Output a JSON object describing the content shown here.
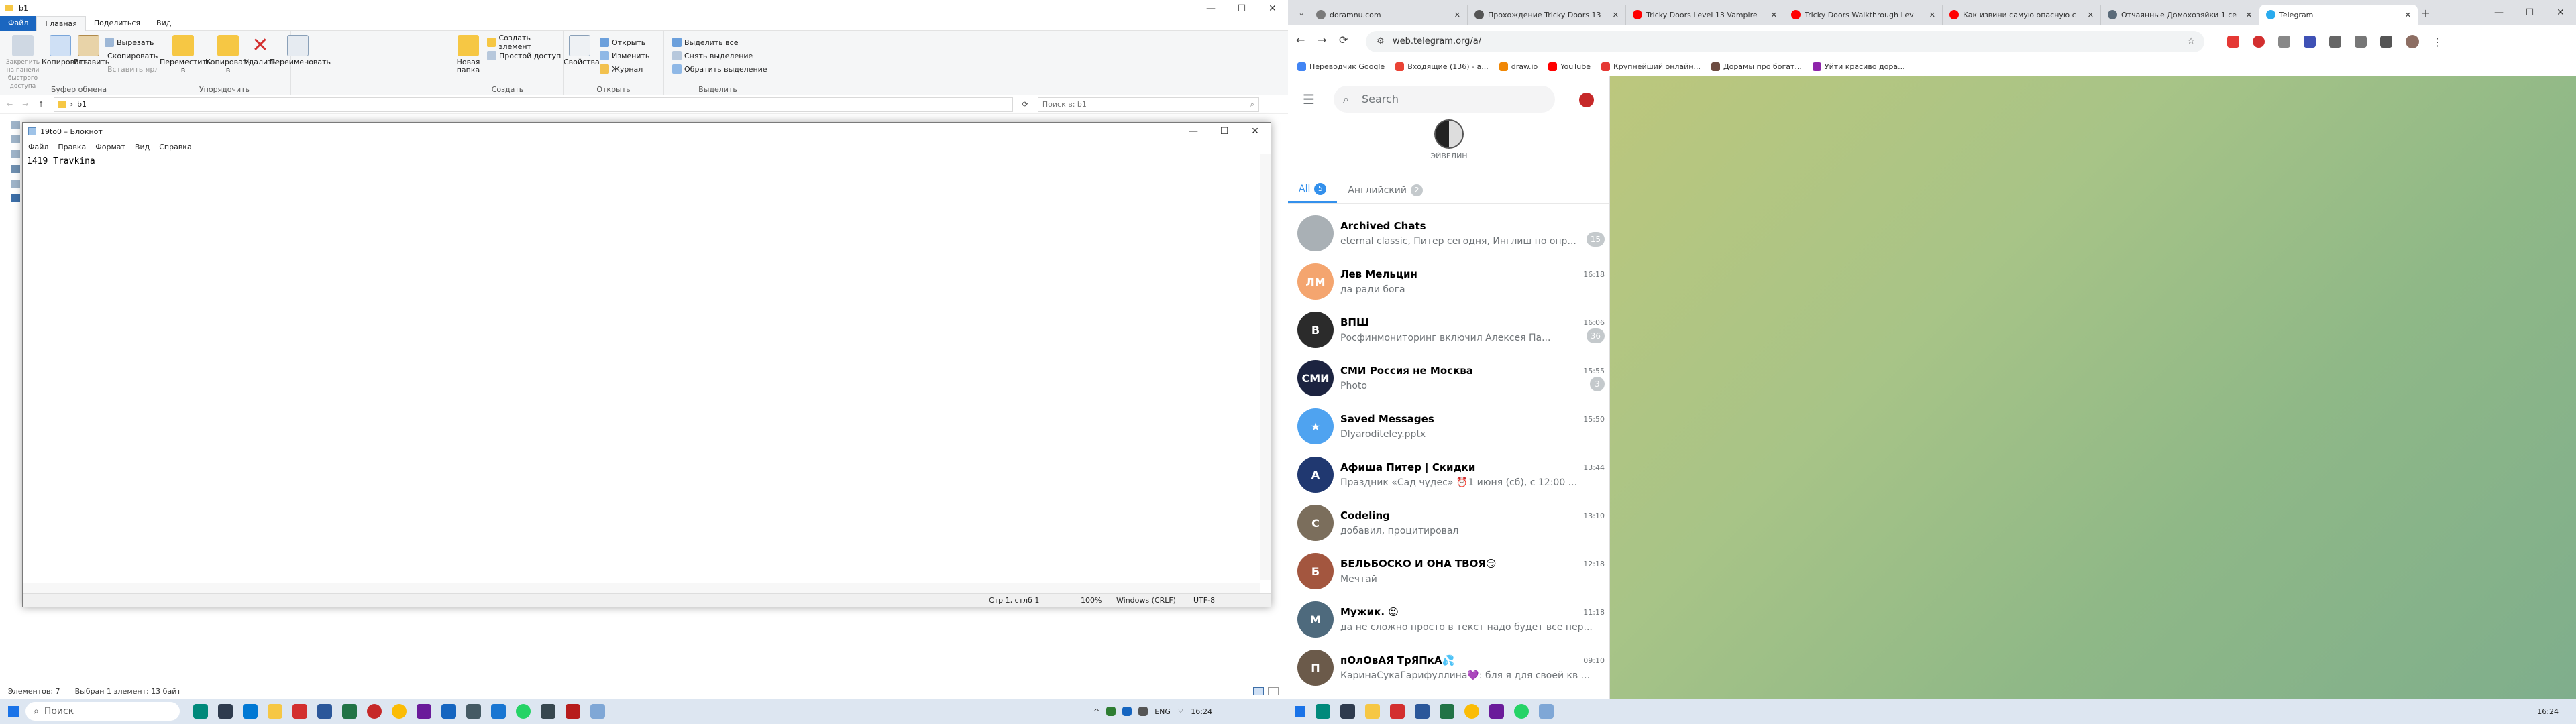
{
  "explorer": {
    "path_title": "b1",
    "window_buttons": [
      "—",
      "☐",
      "✕"
    ],
    "ribbon_tabs": [
      "Файл",
      "Главная",
      "Поделиться",
      "Вид"
    ],
    "clipboard": {
      "pin": "Закрепить на панели быстрого доступа",
      "copy": "Копировать",
      "paste": "Вставить",
      "cut": "Вырезать",
      "copy_path": "Скопировать путь",
      "paste_shortcut": "Вставить ярлык",
      "label": "Буфер обмена"
    },
    "organize": {
      "move": "Переместить в",
      "copy_to": "Копировать в",
      "delete": "Удалить",
      "rename": "Переименовать",
      "label": "Упорядочить"
    },
    "create": {
      "new_folder": "Новая папка",
      "new_item": "Создать элемент",
      "easy_access": "Простой доступ",
      "label": "Создать"
    },
    "open": {
      "properties": "Свойства",
      "open": "Открыть",
      "edit": "Изменить",
      "history": "Журнал",
      "label": "Открыть"
    },
    "select": {
      "all": "Выделить все",
      "none": "Снять выделение",
      "invert": "Обратить выделение",
      "label": "Выделить"
    },
    "address": "b1",
    "search_placeholder": "Поиск в: b1",
    "status_count": "Элементов: 7",
    "status_selected": "Выбран 1 элемент: 13 байт"
  },
  "notepad": {
    "title": "19to0 – Блокнот",
    "menu": [
      "Файл",
      "Правка",
      "Формат",
      "Вид",
      "Справка"
    ],
    "content": "1419 Travkina",
    "status": {
      "position": "Стр 1, стлб 1",
      "zoom": "100%",
      "eol": "Windows (CRLF)",
      "encoding": "UTF-8"
    }
  },
  "chrome": {
    "tabs": [
      {
        "title": "doramnu.com",
        "color": "#7a7a7a"
      },
      {
        "title": "Прохождение Tricky Doors 13",
        "color": "#555555"
      },
      {
        "title": "Tricky Doors Level 13 Vampire",
        "color": "#ff0000"
      },
      {
        "title": "Tricky Doors Walkthrough Lev",
        "color": "#ff0000"
      },
      {
        "title": "Как извини самую опасную с",
        "color": "#ff0000"
      },
      {
        "title": "Отчаянные Домохозяйки 1 се",
        "color": "#5b6b7a"
      },
      {
        "title": "Telegram",
        "color": "#2aabee"
      }
    ],
    "url": "web.telegram.org/a/",
    "bookmarks": [
      {
        "label": "Переводчик Google",
        "color": "#4285f4"
      },
      {
        "label": "Входящие (136) - a...",
        "color": "#ea4335"
      },
      {
        "label": "draw.io",
        "color": "#f08705"
      },
      {
        "label": "YouTube",
        "color": "#ff0000"
      },
      {
        "label": "Крупнейший онлайн...",
        "color": "#e53935"
      },
      {
        "label": "Дорамы про богат...",
        "color": "#6d4c41"
      },
      {
        "label": "Уйти красиво дора...",
        "color": "#8e24aa"
      }
    ]
  },
  "telegram": {
    "search_placeholder": "Search",
    "story_name": "ЭЙВЕЛИН",
    "folders": [
      {
        "label": "All",
        "count": "5"
      },
      {
        "label": "Английский",
        "count": "2"
      }
    ],
    "chats": [
      {
        "name": "Archived Chats",
        "time": "",
        "msg": "eternal classic, Питер сегодня, Инглиш по опр...",
        "badge": "15",
        "avatar": "",
        "color": "#a9b0b5"
      },
      {
        "name": "Лев Мельцин",
        "time": "16:18",
        "msg": "да ради бога",
        "badge": "",
        "avatar": "ЛМ",
        "color": "#f4a56f"
      },
      {
        "name": "ВПШ",
        "time": "16:06",
        "msg": "Росфинмониторинг включил Алексея Па...",
        "badge": "36",
        "avatar": "В",
        "color": "#2b2b2b"
      },
      {
        "name": "СМИ Россия не Москва",
        "time": "15:55",
        "msg": "Photo",
        "badge": "3",
        "avatar": "СМИ",
        "color": "#1c2340"
      },
      {
        "name": "Saved Messages",
        "time": "15:50",
        "msg": "Dlyaroditeley.pptx",
        "badge": "",
        "avatar": "★",
        "color": "#4fa3f0"
      },
      {
        "name": "Афиша Питер | Скидки",
        "time": "13:44",
        "msg": "Праздник «Сад чудес» ⏰1 июня (сб), с 12:00 ...",
        "badge": "",
        "avatar": "А",
        "color": "#203870"
      },
      {
        "name": "Codeling",
        "time": "13:10",
        "msg": "добавил, процитировал",
        "badge": "",
        "avatar": "C",
        "color": "#7b6e5c"
      },
      {
        "name": "БЕЛЬБОСКО И ОНА ТВОЯ😏",
        "time": "12:18",
        "msg": "Мечтай",
        "badge": "",
        "avatar": "Б",
        "color": "#a3563f"
      },
      {
        "name": "Мужик. 😉",
        "time": "11:18",
        "msg": "да не сложно просто в текст надо будет все пер...",
        "badge": "",
        "avatar": "М",
        "color": "#4e6a7d"
      },
      {
        "name": "пОлОвАЯ ТрЯПкА💦",
        "time": "09:10",
        "msg": "КаринаСукаГарифуллина💜: бля я для своей кв ...",
        "badge": "",
        "avatar": "П",
        "color": "#6b5a4a"
      }
    ]
  },
  "taskbar": {
    "search_placeholder": "Поиск",
    "lang": "ENG",
    "time_left": "16:24",
    "time_right": "16:24"
  }
}
